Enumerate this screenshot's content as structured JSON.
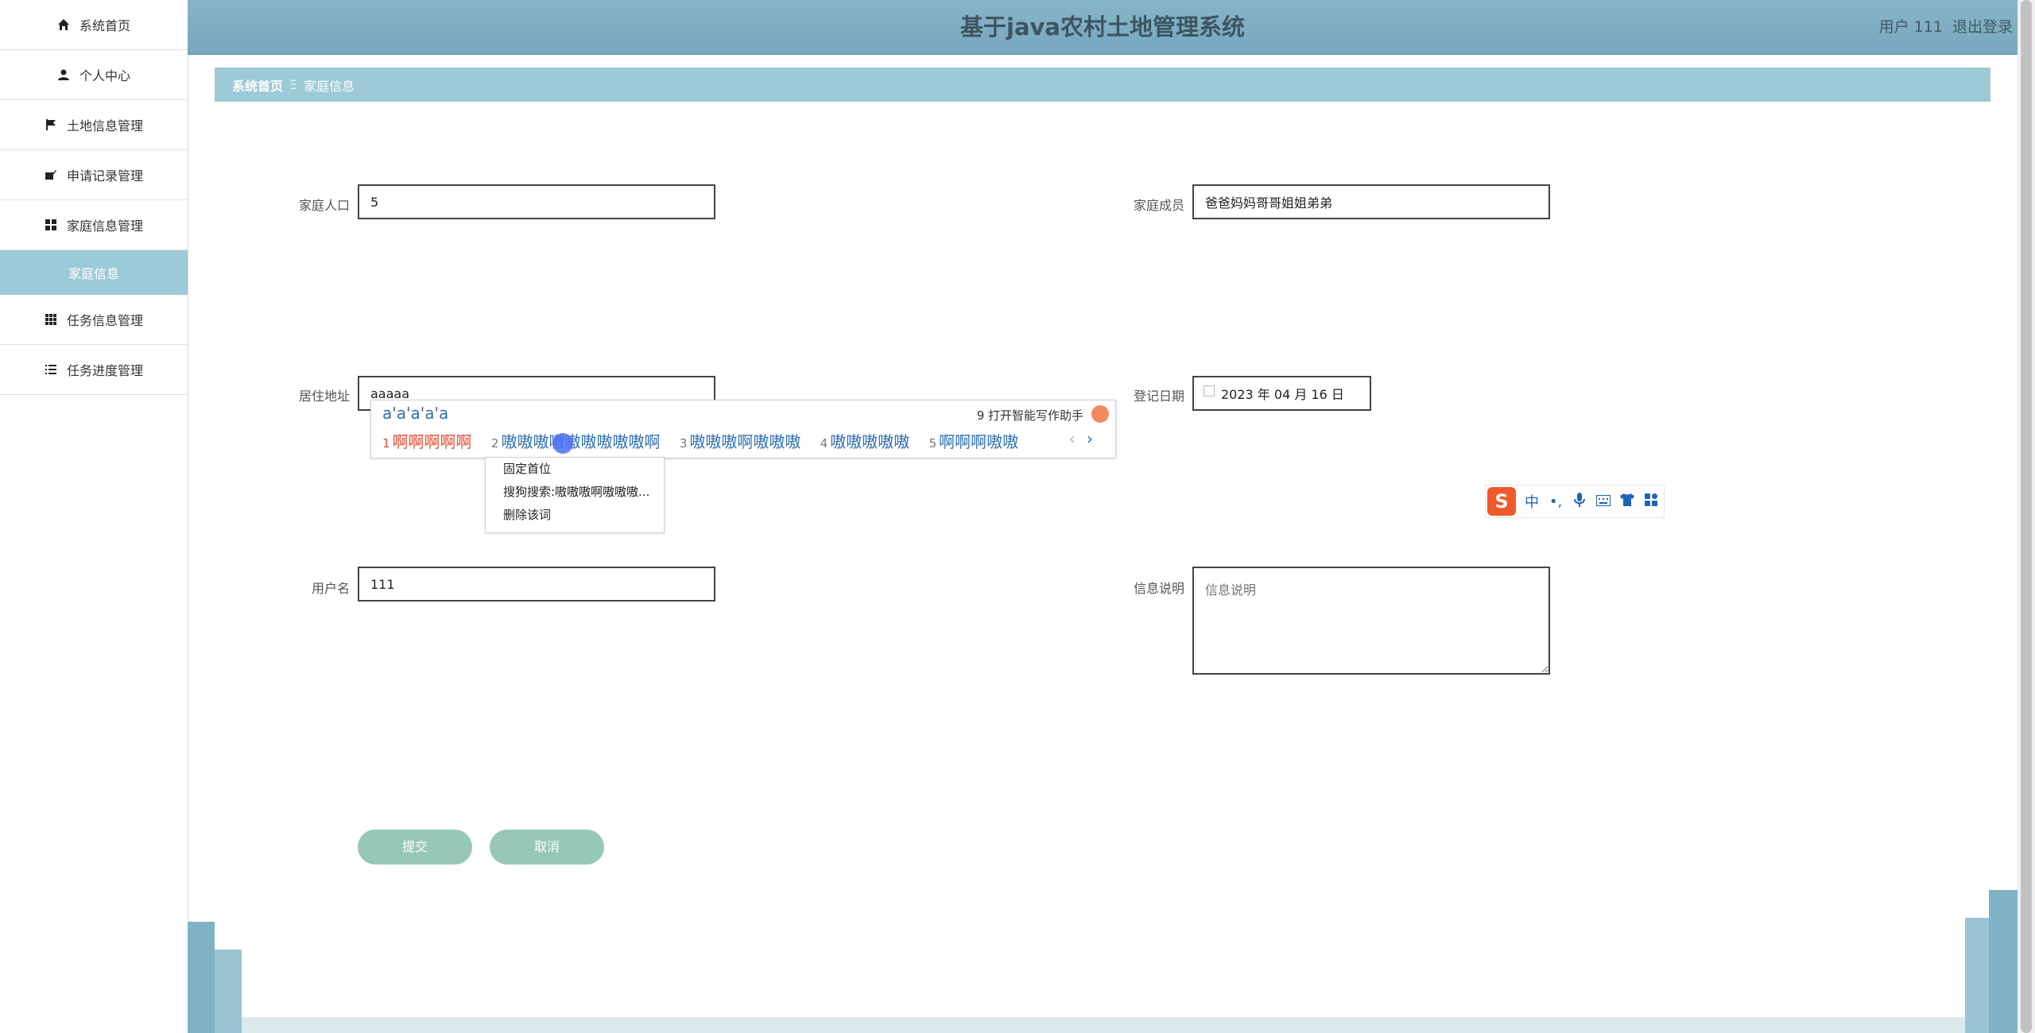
{
  "header": {
    "title": "基于java农村土地管理系统",
    "user_label": "用户 111",
    "logout_label": "退出登录"
  },
  "sidebar": {
    "items": [
      {
        "label": "系统首页",
        "icon": "home-icon"
      },
      {
        "label": "个人中心",
        "icon": "user-icon"
      },
      {
        "label": "土地信息管理",
        "icon": "flag-icon"
      },
      {
        "label": "申请记录管理",
        "icon": "edit-icon"
      },
      {
        "label": "家庭信息管理",
        "icon": "grid-icon"
      }
    ],
    "active_sub": "家庭信息",
    "items2": [
      {
        "label": "任务信息管理",
        "icon": "apps-icon"
      },
      {
        "label": "任务进度管理",
        "icon": "list-icon"
      }
    ]
  },
  "breadcrumb": {
    "home": "系统首页",
    "separator": "Ξ",
    "current": "家庭信息"
  },
  "form": {
    "population": {
      "label": "家庭人口",
      "value": "5"
    },
    "members": {
      "label": "家庭成员",
      "value": "爸爸妈妈哥哥姐姐弟弟"
    },
    "address": {
      "label": "居住地址",
      "value": "aaaaa"
    },
    "register_date": {
      "label": "登记日期",
      "value": "2023 年 04 月 16 日"
    },
    "username": {
      "label": "用户名",
      "value": "111"
    },
    "info": {
      "label": "信息说明",
      "placeholder": "信息说明"
    }
  },
  "buttons": {
    "submit": "提交",
    "cancel": "取消"
  },
  "ime": {
    "composition": "a'a'a'a'a",
    "assist_label": "9 打开智能写作助手",
    "candidates": [
      {
        "num": "1",
        "text": "啊啊啊啊啊"
      },
      {
        "num": "2",
        "text": "嗷嗷嗷嗷嗷嗷嗷嗷嗷啊"
      },
      {
        "num": "3",
        "text": "嗷嗷嗷啊嗷嗷嗷"
      },
      {
        "num": "4",
        "text": "嗷嗷嗷嗷嗷"
      },
      {
        "num": "5",
        "text": "啊啊啊嗷嗷"
      }
    ],
    "prev": "‹",
    "next": "›",
    "context_menu": [
      "固定首位",
      "搜狗搜索:嗷嗷嗷啊嗷嗷嗷...",
      "删除该词"
    ],
    "toolbar": {
      "logo": "S",
      "lang": "中",
      "punct": "•,"
    }
  },
  "colors": {
    "header": "#7aa9bf",
    "breadcrumb": "#9ccad7",
    "button": "#97c8b7",
    "candidate_first": "#e64a2e",
    "candidate": "#2f6fb0"
  }
}
